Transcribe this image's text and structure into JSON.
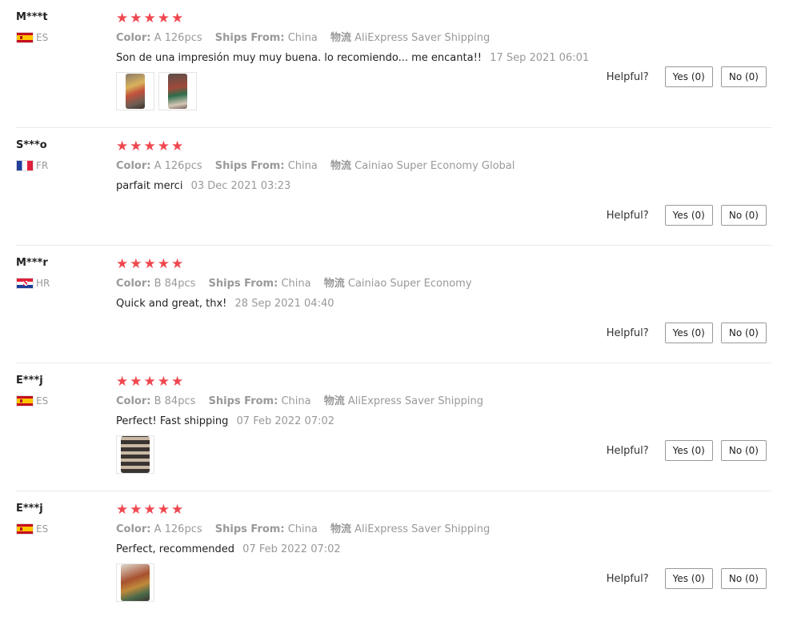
{
  "helpful_label": "Helpful?",
  "reviews": [
    {
      "user": "M***t",
      "country": "ES",
      "stars": "★★★★★",
      "color_label": "Color:",
      "color": "A 126pcs",
      "ships_label": "Ships From:",
      "ships": "China",
      "logistics_label": "物流",
      "logistics": "AliExpress Saver Shipping",
      "text": "Son de una impresión muy muy buena. lo recomiendo... me encanta!!",
      "date": "17 Sep 2021 06:01",
      "yes": "Yes (0)",
      "no": "No (0)"
    },
    {
      "user": "S***o",
      "country": "FR",
      "stars": "★★★★★",
      "color_label": "Color:",
      "color": "A 126pcs",
      "ships_label": "Ships From:",
      "ships": "China",
      "logistics_label": "物流",
      "logistics": "Cainiao Super Economy Global",
      "text": "parfait merci",
      "date": "03 Dec 2021 03:23",
      "yes": "Yes (0)",
      "no": "No (0)"
    },
    {
      "user": "M***r",
      "country": "HR",
      "stars": "★★★★★",
      "color_label": "Color:",
      "color": "B 84pcs",
      "ships_label": "Ships From:",
      "ships": "China",
      "logistics_label": "物流",
      "logistics": "Cainiao Super Economy",
      "text": "Quick and great, thx!",
      "date": "28 Sep 2021 04:40",
      "yes": "Yes (0)",
      "no": "No (0)"
    },
    {
      "user": "E***j",
      "country": "ES",
      "stars": "★★★★★",
      "color_label": "Color:",
      "color": "B 84pcs",
      "ships_label": "Ships From:",
      "ships": "China",
      "logistics_label": "物流",
      "logistics": "AliExpress Saver Shipping",
      "text": "Perfect! Fast shipping",
      "date": "07 Feb 2022 07:02",
      "yes": "Yes (0)",
      "no": "No (0)"
    },
    {
      "user": "E***j",
      "country": "ES",
      "stars": "★★★★★",
      "color_label": "Color:",
      "color": "A 126pcs",
      "ships_label": "Ships From:",
      "ships": "China",
      "logistics_label": "物流",
      "logistics": "AliExpress Saver Shipping",
      "text": "Perfect, recommended",
      "date": "07 Feb 2022 07:02",
      "yes": "Yes (0)",
      "no": "No (0)"
    }
  ]
}
